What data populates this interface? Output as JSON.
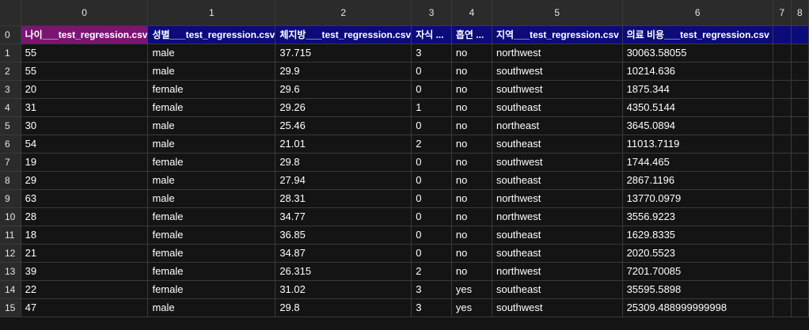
{
  "colors": {
    "header_row_bg": "#0b0b7a",
    "selected_cell_bg": "#7a1573",
    "grid_bg": "#141414",
    "header_bg": "#2b2b2b"
  },
  "col_headers": [
    "0",
    "1",
    "2",
    "3",
    "4",
    "5",
    "6",
    "7",
    "8"
  ],
  "row_headers": [
    "0",
    "1",
    "2",
    "3",
    "4",
    "5",
    "6",
    "7",
    "8",
    "9",
    "10",
    "11",
    "12",
    "13",
    "14",
    "15"
  ],
  "header_row": [
    "나이___test_regression.csv",
    "성별___test_regression.csv",
    "체지방___test_regression.csv",
    "자식 ...",
    "흡연 ...",
    "지역___test_regression.csv",
    "의료 비용___test_regression.csv",
    "",
    ""
  ],
  "rows": [
    [
      "55",
      "male",
      "37.715",
      "3",
      "no",
      "northwest",
      "30063.58055",
      "",
      ""
    ],
    [
      "55",
      "male",
      "29.9",
      "0",
      "no",
      "southwest",
      "10214.636",
      "",
      ""
    ],
    [
      "20",
      "female",
      "29.6",
      "0",
      "no",
      "southwest",
      "1875.344",
      "",
      ""
    ],
    [
      "31",
      "female",
      "29.26",
      "1",
      "no",
      "southeast",
      "4350.5144",
      "",
      ""
    ],
    [
      "30",
      "male",
      "25.46",
      "0",
      "no",
      "northeast",
      "3645.0894",
      "",
      ""
    ],
    [
      "54",
      "male",
      "21.01",
      "2",
      "no",
      "southeast",
      "11013.7119",
      "",
      ""
    ],
    [
      "19",
      "female",
      "29.8",
      "0",
      "no",
      "southwest",
      "1744.465",
      "",
      ""
    ],
    [
      "29",
      "male",
      "27.94",
      "0",
      "no",
      "southeast",
      "2867.1196",
      "",
      ""
    ],
    [
      "63",
      "male",
      "28.31",
      "0",
      "no",
      "northwest",
      "13770.0979",
      "",
      ""
    ],
    [
      "28",
      "female",
      "34.77",
      "0",
      "no",
      "northwest",
      "3556.9223",
      "",
      ""
    ],
    [
      "18",
      "female",
      "36.85",
      "0",
      "no",
      "southeast",
      "1629.8335",
      "",
      ""
    ],
    [
      "21",
      "female",
      "34.87",
      "0",
      "no",
      "southeast",
      "2020.5523",
      "",
      ""
    ],
    [
      "39",
      "female",
      "26.315",
      "2",
      "no",
      "northwest",
      "7201.70085",
      "",
      ""
    ],
    [
      "22",
      "female",
      "31.02",
      "3",
      "yes",
      "southeast",
      "35595.5898",
      "",
      ""
    ],
    [
      "47",
      "male",
      "29.8",
      "3",
      "yes",
      "southwest",
      "25309.488999999998",
      "",
      ""
    ]
  ]
}
